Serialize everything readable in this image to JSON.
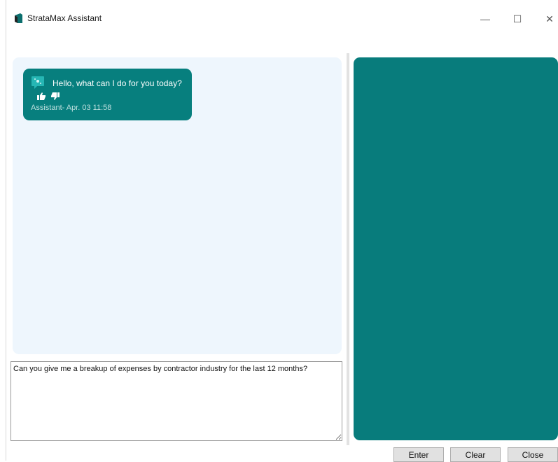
{
  "window": {
    "title": "StrataMax Assistant",
    "minimize_symbol": "—",
    "maximize_symbol": "☐",
    "close_symbol": "✕"
  },
  "chat": {
    "messages": [
      {
        "text": "Hello, what can I do for you today?",
        "meta": "Assistant- Apr. 03 11:58",
        "icon": "bot-icon"
      }
    ]
  },
  "input": {
    "value": "Can you give me a breakup of expenses by contractor industry for the last 12 months?"
  },
  "buttons": {
    "enter": "Enter",
    "clear": "Clear",
    "close": "Close"
  },
  "colors": {
    "accent": "#077f7e",
    "chat_background": "#eef6fd",
    "side_panel": "#087c7c"
  }
}
